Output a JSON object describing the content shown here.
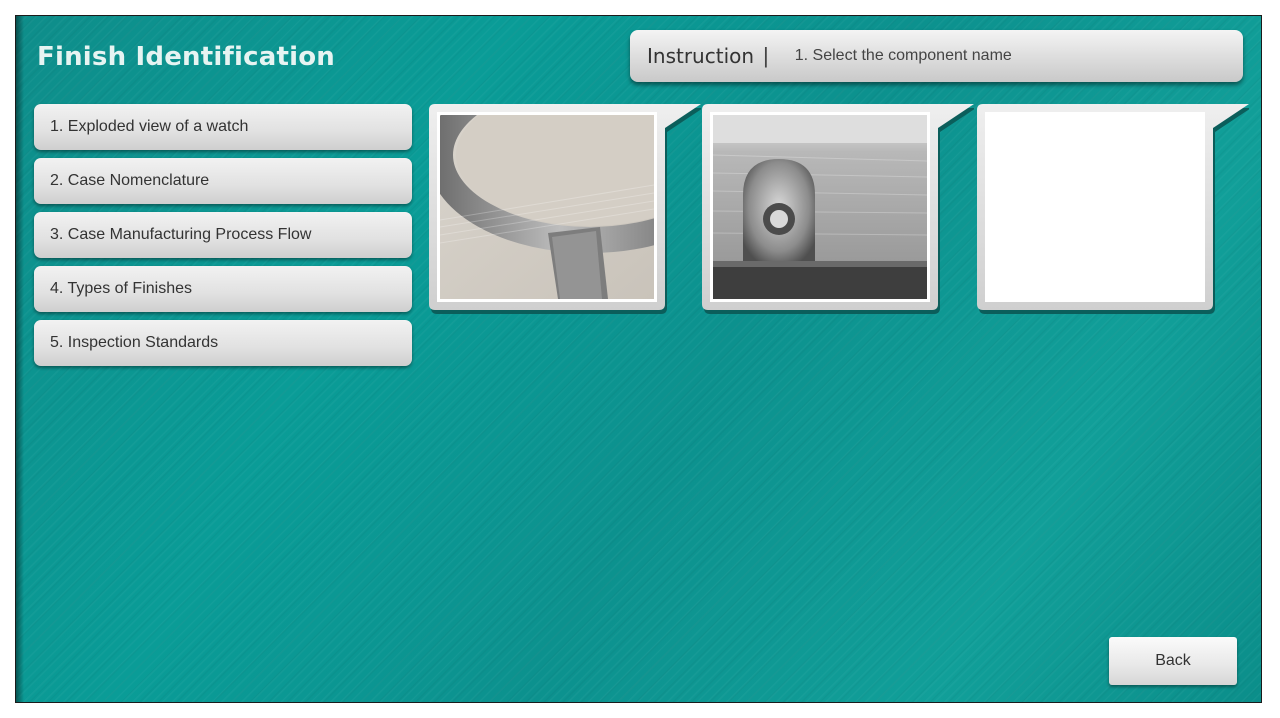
{
  "header": {
    "title": "Finish Identification"
  },
  "instruction": {
    "label": "Instruction",
    "separator": "|",
    "text": "1. Select the component name"
  },
  "menu": {
    "items": [
      {
        "label": "1. Exploded view of a watch"
      },
      {
        "label": "2. Case Nomenclature"
      },
      {
        "label": "3. Case Manufacturing Process Flow"
      },
      {
        "label": "4. Types of Finishes"
      },
      {
        "label": "5. Inspection Standards"
      }
    ]
  },
  "cards": [
    {
      "icon": "case-ring-photo"
    },
    {
      "icon": "case-lug-photo"
    },
    {
      "icon": "blank-photo"
    }
  ],
  "footer": {
    "back_label": "Back"
  },
  "colors": {
    "background": "#0c938f",
    "panel": "#e0e0e0",
    "title_text": "#e6f4f2"
  }
}
